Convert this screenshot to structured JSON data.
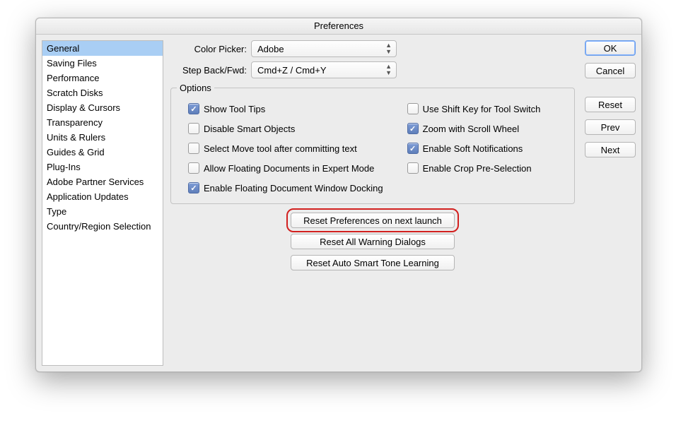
{
  "window": {
    "title": "Preferences"
  },
  "sidebar": {
    "items": [
      "General",
      "Saving Files",
      "Performance",
      "Scratch Disks",
      "Display & Cursors",
      "Transparency",
      "Units & Rulers",
      "Guides & Grid",
      "Plug-Ins",
      "Adobe Partner Services",
      "Application Updates",
      "Type",
      "Country/Region Selection"
    ],
    "selected_index": 0
  },
  "selects": {
    "color_picker": {
      "label": "Color Picker:",
      "value": "Adobe"
    },
    "step_back": {
      "label": "Step Back/Fwd:",
      "value": "Cmd+Z / Cmd+Y"
    }
  },
  "options": {
    "legend": "Options",
    "left": [
      {
        "label": "Show Tool Tips",
        "checked": true
      },
      {
        "label": "Disable Smart Objects",
        "checked": false
      },
      {
        "label": "Select Move tool after committing text",
        "checked": false
      },
      {
        "label": "Allow Floating Documents in Expert Mode",
        "checked": false
      },
      {
        "label": "Enable Floating Document Window Docking",
        "checked": true
      }
    ],
    "right": [
      {
        "label": "Use Shift Key for Tool Switch",
        "checked": false
      },
      {
        "label": "Zoom with Scroll Wheel",
        "checked": true
      },
      {
        "label": "Enable Soft Notifications",
        "checked": true
      },
      {
        "label": "Enable Crop Pre-Selection",
        "checked": false
      }
    ]
  },
  "center_buttons": {
    "reset_prefs": "Reset Preferences on next launch",
    "reset_warn": "Reset All Warning Dialogs",
    "reset_smart": "Reset Auto Smart Tone Learning"
  },
  "right_buttons": {
    "ok": "OK",
    "cancel": "Cancel",
    "reset": "Reset",
    "prev": "Prev",
    "next": "Next"
  }
}
